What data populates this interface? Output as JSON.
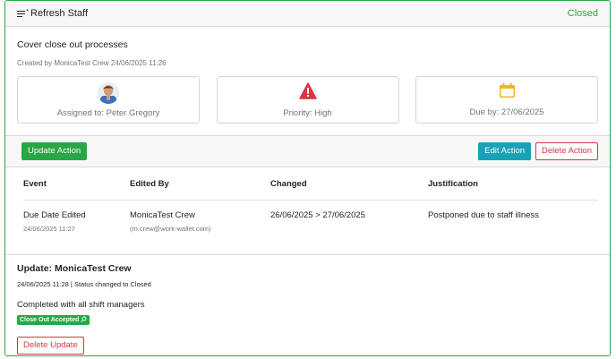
{
  "header": {
    "title": "Refresh Staff",
    "status": "Closed"
  },
  "summary": {
    "title": "Cover close out processes",
    "created": "Created by MonicaTest Crew 24/06/2025 11:26",
    "assigned": "Assigned to: Peter Gregory",
    "priority": "Priority: High",
    "due": "Due by: 27/06/2025"
  },
  "actions": {
    "update_label": "Update Action",
    "edit_label": "Edit Action",
    "delete_label": "Delete Action"
  },
  "history": {
    "columns": [
      "Event",
      "Edited By",
      "Changed",
      "Justification"
    ],
    "rows": [
      {
        "event": "Due Date Edited",
        "event_time": "24/06/2025 11:27",
        "editor": "MonicaTest Crew",
        "editor_email": "(m.crew@work-wallet.com)",
        "changed": "26/06/2025 > 27/06/2025",
        "justification": "Postponed due to staff illness"
      }
    ]
  },
  "update": {
    "title": "Update: MonicaTest Crew",
    "meta": "24/06/2025 11:28  | Status changed to Closed",
    "text": "Completed with all shift managers",
    "badge": "Close Out Accepted",
    "delete_label": "Delete Update"
  },
  "colors": {
    "success": "#28a745",
    "info": "#17a2b8",
    "danger": "#dc3545",
    "warning": "#f0b429"
  }
}
